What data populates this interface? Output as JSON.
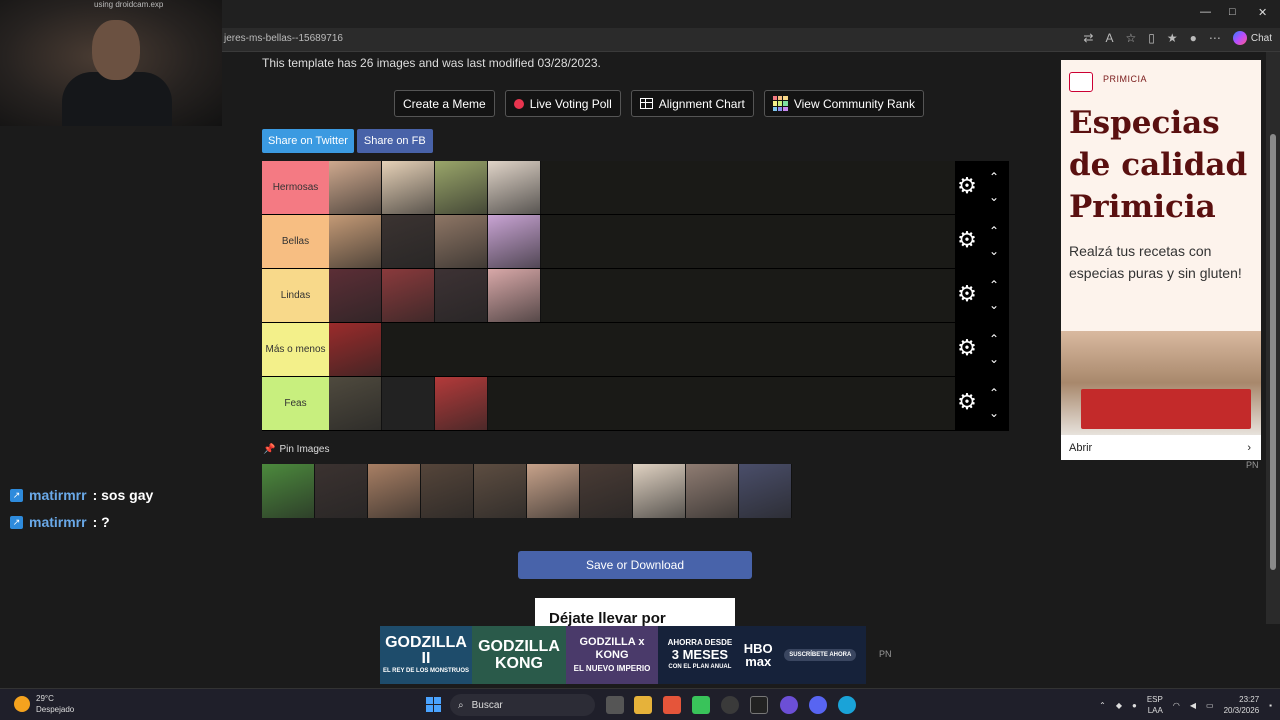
{
  "browser": {
    "url": "jeres-ms-bellas--15689716",
    "chat_label": "Chat",
    "win_min": "—",
    "win_max": "□",
    "win_close": "✕"
  },
  "webcam": {
    "label": "using droidcam.exp"
  },
  "page": {
    "info_text": "This template has 26 images and was last modified 03/28/2023.",
    "buttons": {
      "create_meme": "Create a Meme",
      "live_voting": "Live Voting Poll",
      "alignment": "Alignment Chart",
      "community_rank": "View Community Rank"
    },
    "share": {
      "twitter": "Share on Twitter",
      "fb": "Share on FB"
    },
    "tiers": [
      {
        "label": "Hermosas",
        "color": "#f47a83",
        "images": [
          "#cfa98e",
          "#e6d1b7",
          "#9aa66a",
          "#e0d4c8"
        ]
      },
      {
        "label": "Bellas",
        "color": "#f7be82",
        "images": [
          "#c49a76",
          "#3b3331",
          "#8e7665",
          "#c9a4d4"
        ]
      },
      {
        "label": "Lindas",
        "color": "#f8d98a",
        "images": [
          "#5c2e36",
          "#8a3a3c",
          "#3d3234",
          "#d8a8a8"
        ]
      },
      {
        "label": "Más o menos",
        "color": "#f3f08a",
        "images": [
          "#9b2b2b"
        ]
      },
      {
        "label": "Feas",
        "color": "#c8ef7e",
        "images": [
          "#4f4a3e",
          "#222222",
          "#b33a3a"
        ]
      }
    ],
    "pin_label": "Pin Images",
    "pool_images": [
      "#4c8a3d",
      "#3b3230",
      "#a87f64",
      "#55453a",
      "#5d4d41",
      "#c7a28a",
      "#493b35",
      "#e0d2c2",
      "#8f7c72",
      "#4a4e6a"
    ],
    "save_button": "Save or Download"
  },
  "side_ad": {
    "brand": "PRIMICIA",
    "title": "Especias de calidad Primicia",
    "body": "Realzá tus recetas con especias puras y sin gluten!",
    "cta": "Abrir",
    "cta_arrow": "›",
    "pn": "PN"
  },
  "bottom_ad": {
    "top_text": "Déjate llevar por",
    "panels": [
      "GODZILLA II",
      "EL REY DE LOS MONSTRUOS",
      "GODZILLA",
      "KONG",
      "GODZILLA x KONG",
      "EL NUEVO IMPERIO",
      "AHORRA DESDE",
      "3 MESES",
      "CON EL PLAN ANUAL",
      "HBO max",
      "SUSCRÍBETE AHORA"
    ],
    "pn": "PN"
  },
  "chat": [
    {
      "user": "matirmrr",
      "message": ": sos gay"
    },
    {
      "user": "matirmrr",
      "message": ": ?"
    }
  ],
  "taskbar": {
    "temperature": "29°C",
    "weather": "Despejado",
    "search": "Buscar",
    "lang": "ESP",
    "lang2": "LAA",
    "time": "23:27",
    "date": "20/3/2026"
  }
}
